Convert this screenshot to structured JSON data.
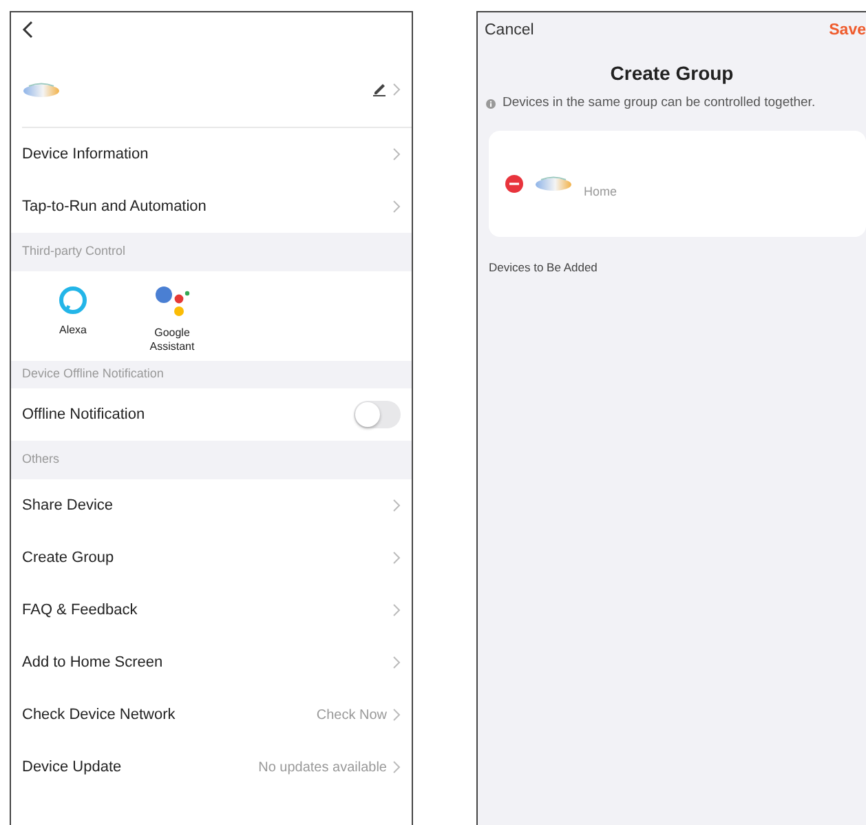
{
  "settings_screen": {
    "top_items": [
      {
        "label": "Device Information"
      },
      {
        "label": "Tap-to-Run and Automation"
      }
    ],
    "third_party": {
      "header": "Third-party Control",
      "services": [
        {
          "kind": "alexa",
          "label": "Alexa"
        },
        {
          "kind": "google",
          "label": "Google Assistant"
        }
      ]
    },
    "offline": {
      "header": "Device Offline Notification",
      "label": "Offline Notification",
      "on": false
    },
    "others": {
      "header": "Others",
      "items": [
        {
          "label": "Share Device"
        },
        {
          "label": "Create Group"
        },
        {
          "label": "FAQ & Feedback"
        },
        {
          "label": "Add to Home Screen"
        },
        {
          "label": "Check Device Network",
          "value": "Check Now"
        },
        {
          "label": "Device Update",
          "value": "No updates available"
        }
      ]
    }
  },
  "group_screen": {
    "cancel": "Cancel",
    "save": "Save",
    "title": "Create Group",
    "info": "Devices in the same group can be controlled together.",
    "devices": [
      {
        "room": "Home"
      }
    ],
    "section": "Devices to Be Added"
  }
}
